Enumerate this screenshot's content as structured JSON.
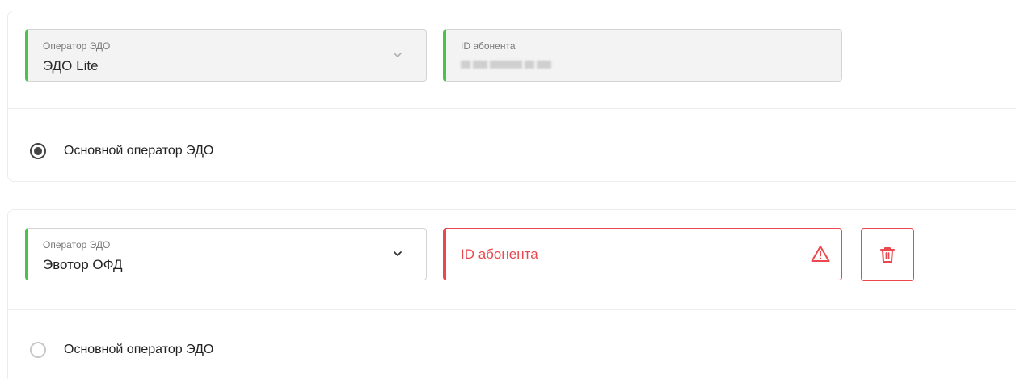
{
  "entries": [
    {
      "operator_label": "Оператор ЭДО",
      "operator_value": "ЭДО Lite",
      "id_label": "ID абонента",
      "main_label": "Основной оператор ЭДО",
      "main_selected": true
    },
    {
      "operator_label": "Оператор ЭДО",
      "operator_value": "Эвотор ОФД",
      "id_placeholder": "ID абонента",
      "main_label": "Основной оператор ЭДО",
      "main_selected": false
    }
  ],
  "colors": {
    "accent_green": "#4cc24a",
    "error_red": "#e8484e",
    "border": "#d4d4d4"
  },
  "icons": {
    "chevron": "chevron-down-icon",
    "warning": "warning-icon",
    "delete": "trash-icon"
  }
}
